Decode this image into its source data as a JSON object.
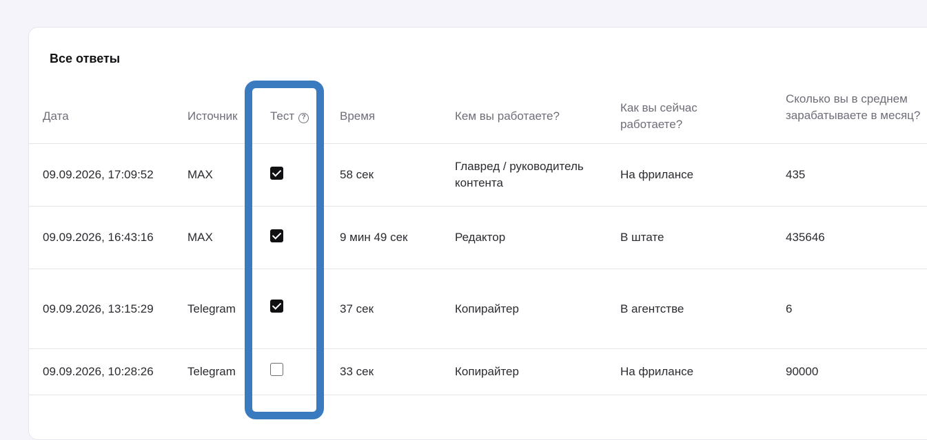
{
  "card": {
    "title": "Все ответы"
  },
  "headers": {
    "date": "Дата",
    "source": "Источник",
    "test": "Тест",
    "time": "Время",
    "role": "Кем вы работаете?",
    "work_mode": "Как вы сейчас работаете?",
    "income": "Сколько вы в среднем зарабатываете в месяц?"
  },
  "help_icon_glyph": "?",
  "rows": [
    {
      "date": "09.09.2026, 17:09:52",
      "source": "MAX",
      "test": true,
      "time": "58 сек",
      "role": "Главред / руководитель контента",
      "work_mode": "На фрилансе",
      "income": "435"
    },
    {
      "date": "09.09.2026, 16:43:16",
      "source": "MAX",
      "test": true,
      "time": "9 мин 49 сек",
      "role": "Редактор",
      "work_mode": "В штате",
      "income": "435646"
    },
    {
      "date": "09.09.2026, 13:15:29",
      "source": "Telegram",
      "test": true,
      "time": "37 сек",
      "role": "Копирайтер",
      "work_mode": "В агентстве",
      "income": "6"
    },
    {
      "date": "09.09.2026, 10:28:26",
      "source": "Telegram",
      "test": false,
      "time": "33 сек",
      "role": "Копирайтер",
      "work_mode": "На фрилансе",
      "income": "90000"
    }
  ],
  "colors": {
    "highlight": "#3a7abf",
    "checkbox_checked": "#111114",
    "background": "#f5f4fb"
  }
}
